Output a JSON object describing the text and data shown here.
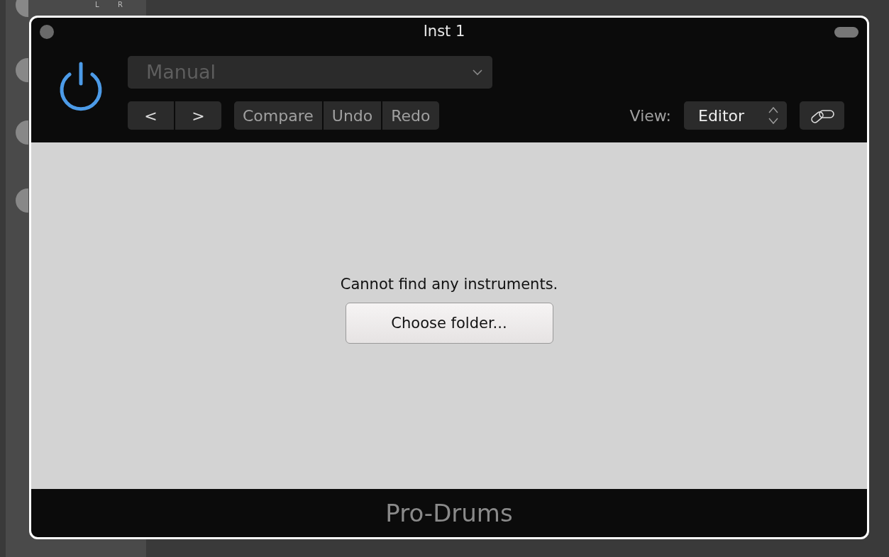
{
  "background": {
    "pan_labels": [
      "L",
      "R"
    ]
  },
  "window": {
    "title": "Inst 1"
  },
  "header": {
    "power": {
      "on": true
    },
    "preset": {
      "value": "Manual",
      "disabled": true
    },
    "nav_buttons": [
      "<",
      ">"
    ],
    "actions": [
      "Compare",
      "Undo",
      "Redo"
    ],
    "view_label": "View:",
    "view_select": {
      "value": "Editor"
    }
  },
  "content": {
    "message": "Cannot find any instruments.",
    "button": "Choose folder..."
  },
  "footer": {
    "plugin_name": "Pro-Drums"
  }
}
